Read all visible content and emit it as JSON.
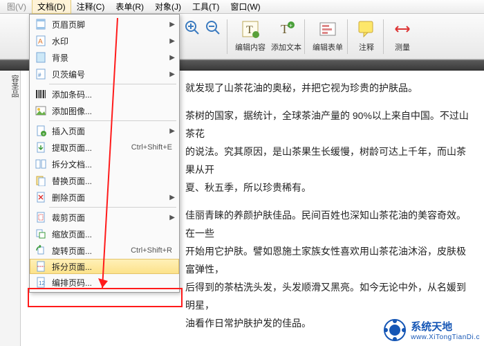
{
  "menubar": {
    "items": [
      {
        "label": "图(V)",
        "active": false
      },
      {
        "label": "文档(D)",
        "active": true
      },
      {
        "label": "注释(C)",
        "active": false
      },
      {
        "label": "表单(R)",
        "active": false
      },
      {
        "label": "对象(J)",
        "active": false
      },
      {
        "label": "工具(T)",
        "active": false
      },
      {
        "label": "窗口(W)",
        "active": false
      }
    ]
  },
  "toolbar": {
    "edit_content": "编辑内容",
    "add_text": "添加文本",
    "edit_form": "编辑表单",
    "annotate": "注释",
    "measure": "测量"
  },
  "sidestrip_text": "容圣品",
  "content": {
    "p1": "就发现了山茶花油的奥秘，并把它视为珍贵的护肤品。",
    "p2_a": "茶树的国家，据统计，全球茶油产量的 90%以上来自中国。不过山茶花",
    "p2_b": "的说法。究其原因，是山茶果生长缓慢，树龄可达上千年，而山茶果从开",
    "p2_c": "夏、秋五季，所以珍贵稀有。",
    "p3_a": "佳丽青睐的养颜护肤佳品。民间百姓也深知山茶花油的美容奇效。在一些",
    "p3_b": "开始用它护肤。譬如恩施土家族女性喜欢用山茶花油沐浴，皮肤极富弹性，",
    "p3_c": "后得到的茶枯洗头发，头发顺滑又黑亮。如今无论中外，从名媛到明星，",
    "p3_d": "油看作日常护肤护发的佳品。"
  },
  "dropdown": {
    "items": [
      {
        "icon": "header-footer-icon",
        "label": "页眉页脚",
        "shortcut": "",
        "submenu": true
      },
      {
        "icon": "watermark-icon",
        "label": "水印",
        "shortcut": "",
        "submenu": true
      },
      {
        "icon": "background-icon",
        "label": "背景",
        "shortcut": "",
        "submenu": true
      },
      {
        "icon": "bates-icon",
        "label": "贝茨编号",
        "shortcut": "",
        "submenu": true
      },
      {
        "sep": true
      },
      {
        "icon": "barcode-icon",
        "label": "添加条码...",
        "shortcut": "",
        "submenu": false
      },
      {
        "icon": "image-icon",
        "label": "添加图像...",
        "shortcut": "",
        "submenu": false
      },
      {
        "sep": true
      },
      {
        "icon": "insert-page-icon",
        "label": "插入页面",
        "shortcut": "",
        "submenu": true
      },
      {
        "icon": "extract-page-icon",
        "label": "提取页面...",
        "shortcut": "Ctrl+Shift+E",
        "submenu": false
      },
      {
        "icon": "split-doc-icon",
        "label": "拆分文档...",
        "shortcut": "",
        "submenu": false
      },
      {
        "icon": "replace-page-icon",
        "label": "替换页面...",
        "shortcut": "",
        "submenu": false
      },
      {
        "icon": "delete-page-icon",
        "label": "删除页面",
        "shortcut": "",
        "submenu": true
      },
      {
        "sep": true
      },
      {
        "icon": "crop-page-icon",
        "label": "裁剪页面",
        "shortcut": "",
        "submenu": true
      },
      {
        "icon": "scale-page-icon",
        "label": "缩放页面...",
        "shortcut": "",
        "submenu": false
      },
      {
        "icon": "rotate-page-icon",
        "label": "旋转页面...",
        "shortcut": "Ctrl+Shift+R",
        "submenu": false
      },
      {
        "icon": "split-page-icon",
        "label": "拆分页面...",
        "shortcut": "",
        "submenu": false,
        "highlight": true
      },
      {
        "icon": "renumber-icon",
        "label": "编排页码...",
        "shortcut": "",
        "submenu": false
      }
    ]
  },
  "watermark": {
    "title": "系统天地",
    "url": "www.XiTongTianDi.c"
  }
}
